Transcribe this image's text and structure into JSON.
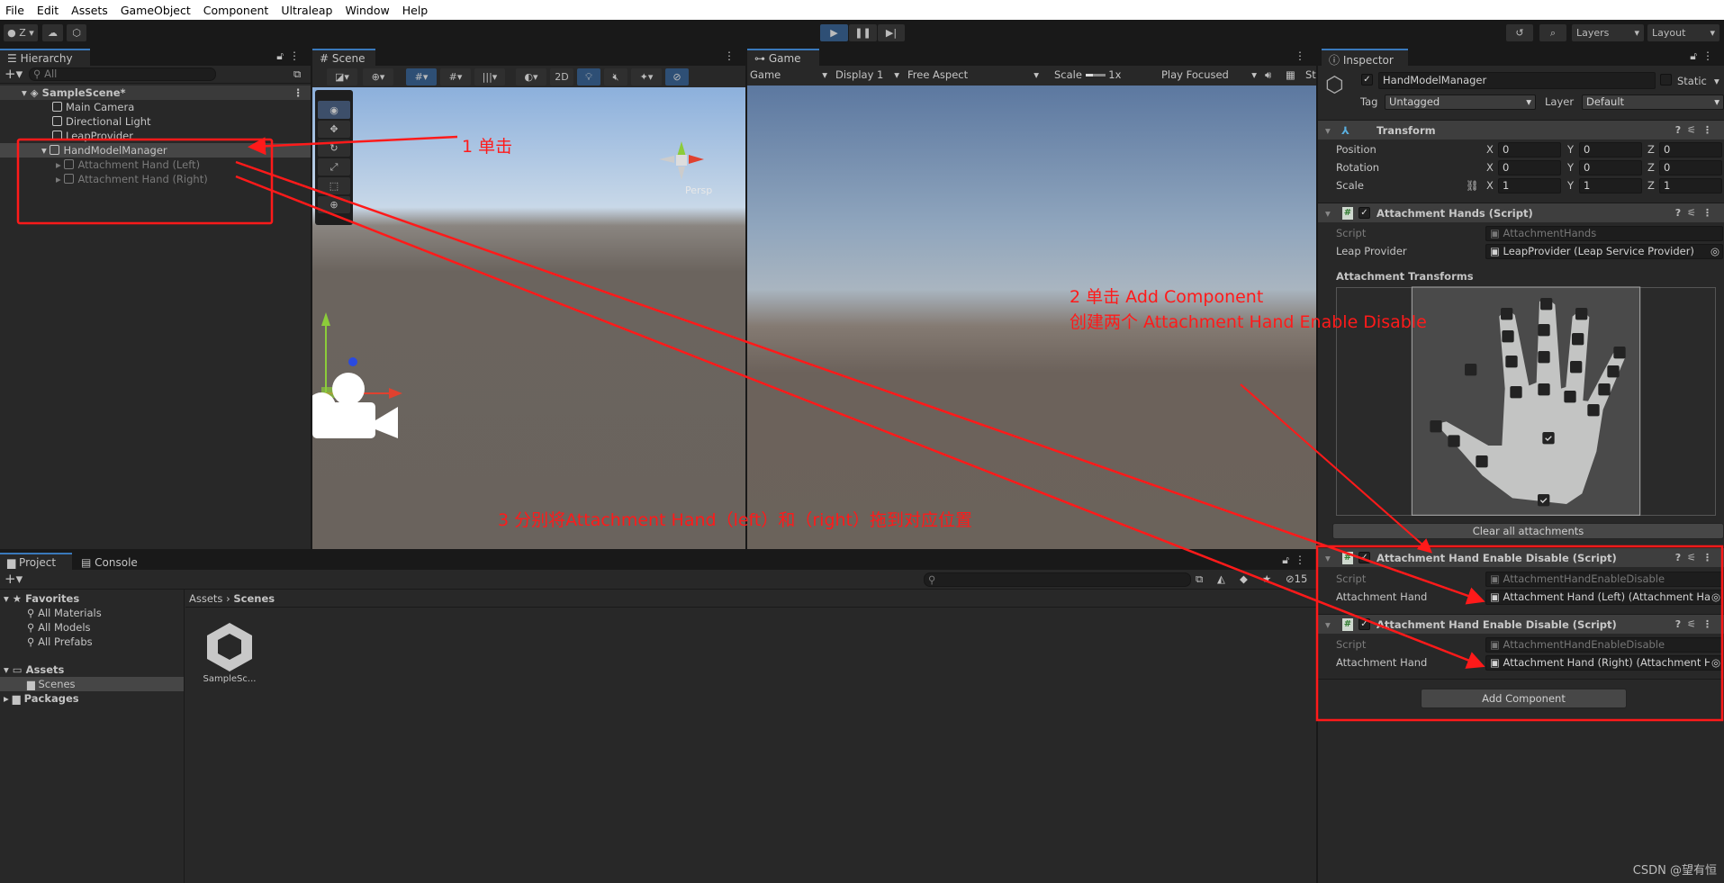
{
  "menu": [
    "File",
    "Edit",
    "Assets",
    "GameObject",
    "Component",
    "Ultraleap",
    "Window",
    "Help"
  ],
  "toolbar": {
    "account": "Z",
    "layers": "Layers",
    "layout": "Layout",
    "play_icon": "play-icon",
    "pause_icon": "pause-icon",
    "step_icon": "step-icon"
  },
  "hierarchy": {
    "tab": "Hierarchy",
    "search_placeholder": "All",
    "scene": "SampleScene*",
    "items": [
      {
        "label": "Main Camera"
      },
      {
        "label": "Directional Light"
      },
      {
        "label": "LeapProvider"
      },
      {
        "label": "HandModelManager"
      },
      {
        "label": "Attachment Hand (Left)"
      },
      {
        "label": "Attachment Hand (Right)"
      }
    ]
  },
  "scene": {
    "tab": "Scene",
    "btn_2d": "2D",
    "persp": "Persp"
  },
  "game": {
    "tab": "Game",
    "mode": "Game",
    "display": "Display 1",
    "aspect": "Free Aspect",
    "scale_label": "Scale",
    "scale_value": "1x",
    "play_mode": "Play Focused",
    "stats": "St"
  },
  "inspector": {
    "tab": "Inspector",
    "object_name": "HandModelManager",
    "static": "Static",
    "tag_label": "Tag",
    "tag": "Untagged",
    "layer_label": "Layer",
    "layer": "Default",
    "transform": {
      "title": "Transform",
      "rows": [
        {
          "label": "Position",
          "x": "0",
          "y": "0",
          "z": "0"
        },
        {
          "label": "Rotation",
          "x": "0",
          "y": "0",
          "z": "0"
        },
        {
          "label": "Scale",
          "x": "1",
          "y": "1",
          "z": "1"
        }
      ]
    },
    "attachment_hands": {
      "title": "Attachment Hands (Script)",
      "script_label": "Script",
      "script": "AttachmentHands",
      "provider_label": "Leap Provider",
      "provider": "LeapProvider (Leap Service Provider)",
      "transforms_label": "Attachment Transforms",
      "clear_button": "Clear all attachments"
    },
    "enable_disable": [
      {
        "title": "Attachment Hand Enable Disable (Script)",
        "script_label": "Script",
        "script": "AttachmentHandEnableDisable",
        "hand_label": "Attachment Hand",
        "hand": "Attachment Hand (Left) (Attachment Hand)"
      },
      {
        "title": "Attachment Hand Enable Disable (Script)",
        "script_label": "Script",
        "script": "AttachmentHandEnableDisable",
        "hand_label": "Attachment Hand",
        "hand": "Attachment Hand (Right) (Attachment Hand)"
      }
    ],
    "add_component": "Add Component"
  },
  "project": {
    "tab": "Project",
    "console_tab": "Console",
    "favorites": "Favorites",
    "fav_items": [
      "All Materials",
      "All Models",
      "All Prefabs"
    ],
    "assets": "Assets",
    "scenes": "Scenes",
    "packages": "Packages",
    "breadcrumb": [
      "Assets",
      "Scenes"
    ],
    "asset_item": "SampleSc...",
    "hidden_count": "15"
  },
  "annotations": {
    "step1": "1 单击",
    "step2_line1": "2 单击 Add Component",
    "step2_line2": "创建两个 Attachment Hand Enable Disable",
    "step3": "3 分别将Attachment Hand（left）和（right）拖到对应位置"
  },
  "watermark": "CSDN @望有恒",
  "colors": {
    "annotation": "#ff1a1a",
    "accent": "#3a79bb",
    "play_active": "#2e4f75"
  }
}
